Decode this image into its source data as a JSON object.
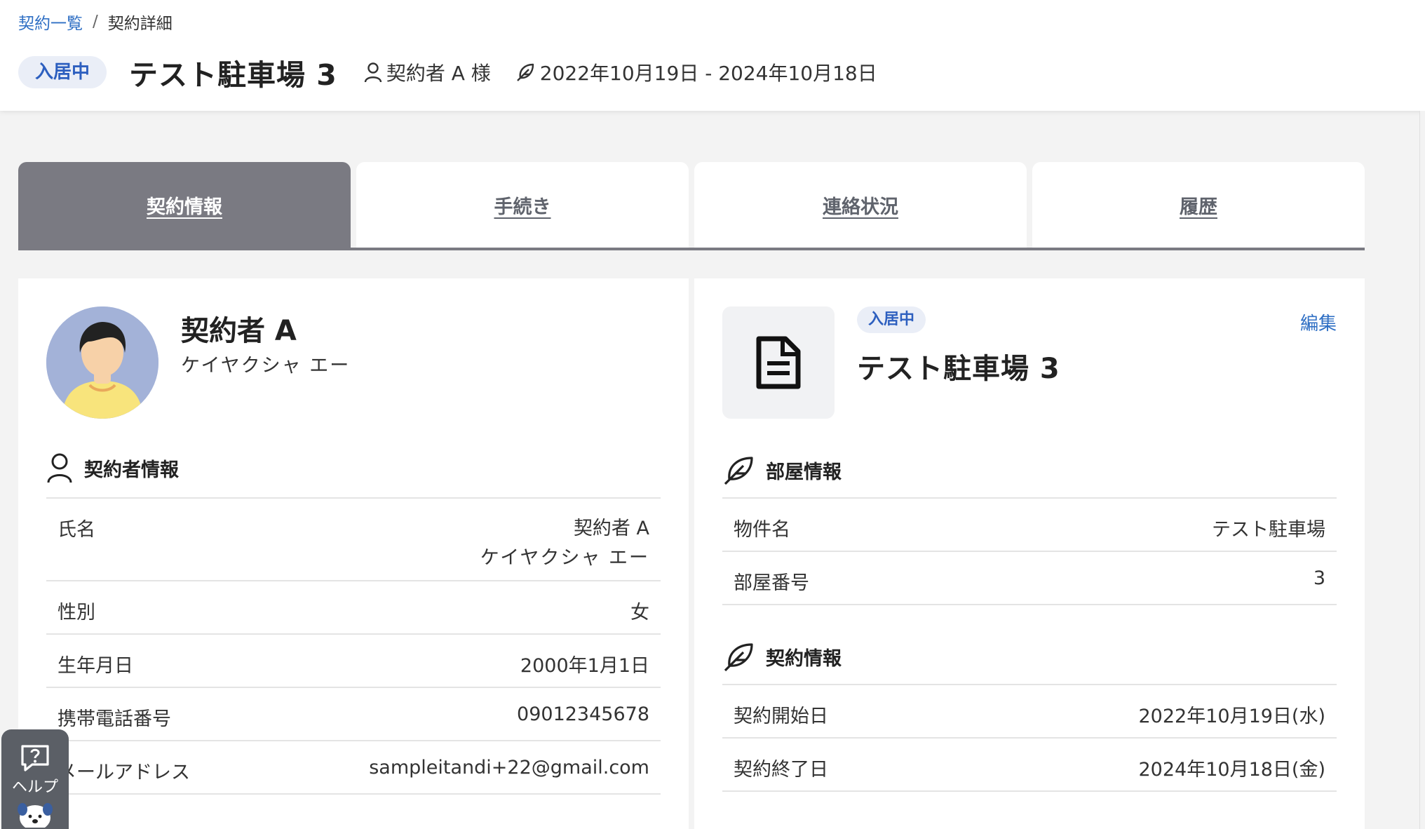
{
  "breadcrumb": {
    "parent": "契約一覧",
    "separator": "/",
    "current": "契約詳細"
  },
  "header": {
    "status": "入居中",
    "title": "テスト駐車場 3",
    "contractor": "契約者 A 様",
    "period": "2022年10月19日 - 2024年10月18日"
  },
  "tabs": [
    {
      "label": "契約情報",
      "active": true
    },
    {
      "label": "手続き",
      "active": false
    },
    {
      "label": "連絡状況",
      "active": false
    },
    {
      "label": "履歴",
      "active": false
    }
  ],
  "person": {
    "name": "契約者 A",
    "kana": "ケイヤクシャ エー",
    "section_title": "契約者情報",
    "rows": [
      {
        "label": "氏名",
        "value": "契約者 A",
        "value2": "ケイヤクシャ エー"
      },
      {
        "label": "性別",
        "value": "女"
      },
      {
        "label": "生年月日",
        "value": "2000年1月1日"
      },
      {
        "label": "携帯電話番号",
        "value": "09012345678"
      },
      {
        "label": "メールアドレス",
        "value": "sampleitandi+22@gmail.com"
      }
    ]
  },
  "property": {
    "status": "入居中",
    "edit_label": "編集",
    "title": "テスト駐車場 3",
    "room_section_title": "部屋情報",
    "room_rows": [
      {
        "label": "物件名",
        "value": "テスト駐車場"
      },
      {
        "label": "部屋番号",
        "value": "3"
      }
    ],
    "contract_section_title": "契約情報",
    "contract_rows": [
      {
        "label": "契約開始日",
        "value": "2022年10月19日(水)"
      },
      {
        "label": "契約終了日",
        "value": "2024年10月18日(金)"
      }
    ]
  },
  "help": {
    "label": "ヘルプ"
  },
  "colors": {
    "accent": "#2d5fbf",
    "tab_active": "#7a7a82",
    "badge_bg": "#eaeef7"
  }
}
